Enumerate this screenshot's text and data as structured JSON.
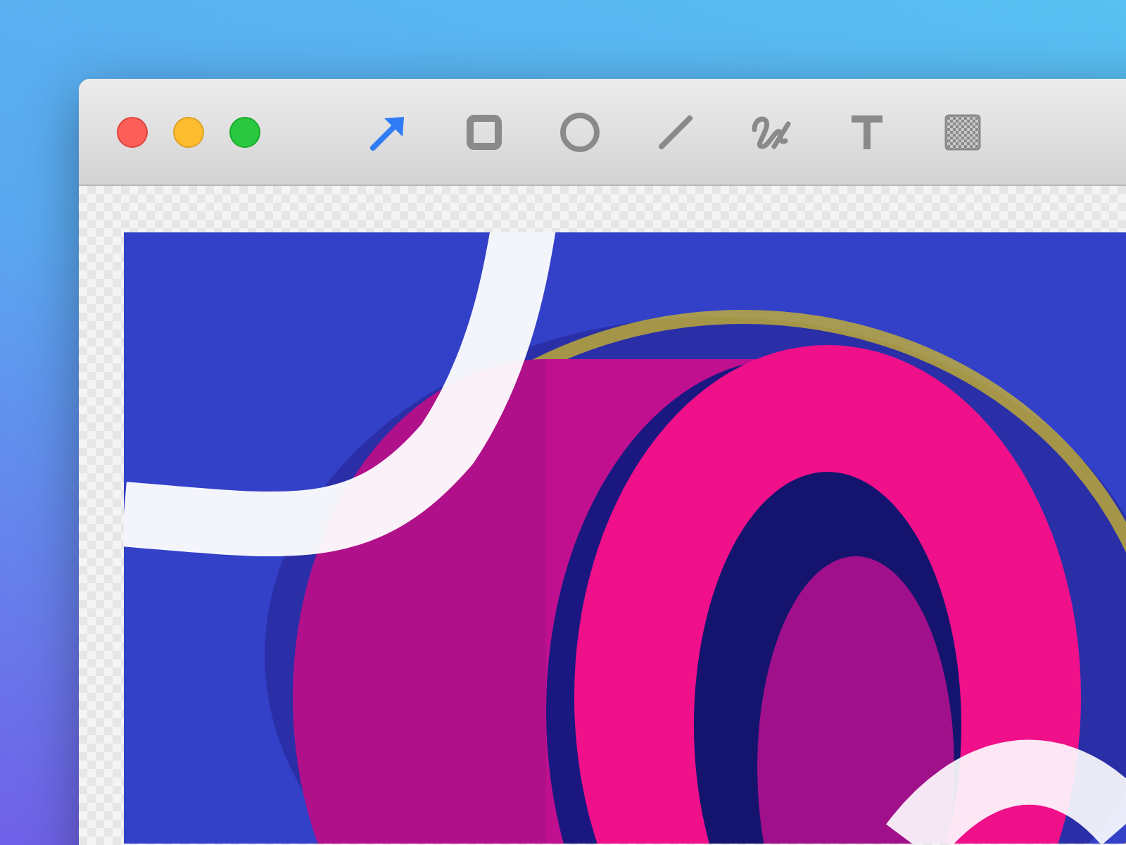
{
  "toolbar": {
    "tools": [
      {
        "kind": "arrow",
        "selected": true
      },
      {
        "kind": "rectangle",
        "selected": false
      },
      {
        "kind": "ellipse",
        "selected": false
      },
      {
        "kind": "line",
        "selected": false
      },
      {
        "kind": "freehand",
        "selected": false
      },
      {
        "kind": "text",
        "selected": false
      },
      {
        "kind": "pixelate",
        "selected": false
      }
    ]
  }
}
